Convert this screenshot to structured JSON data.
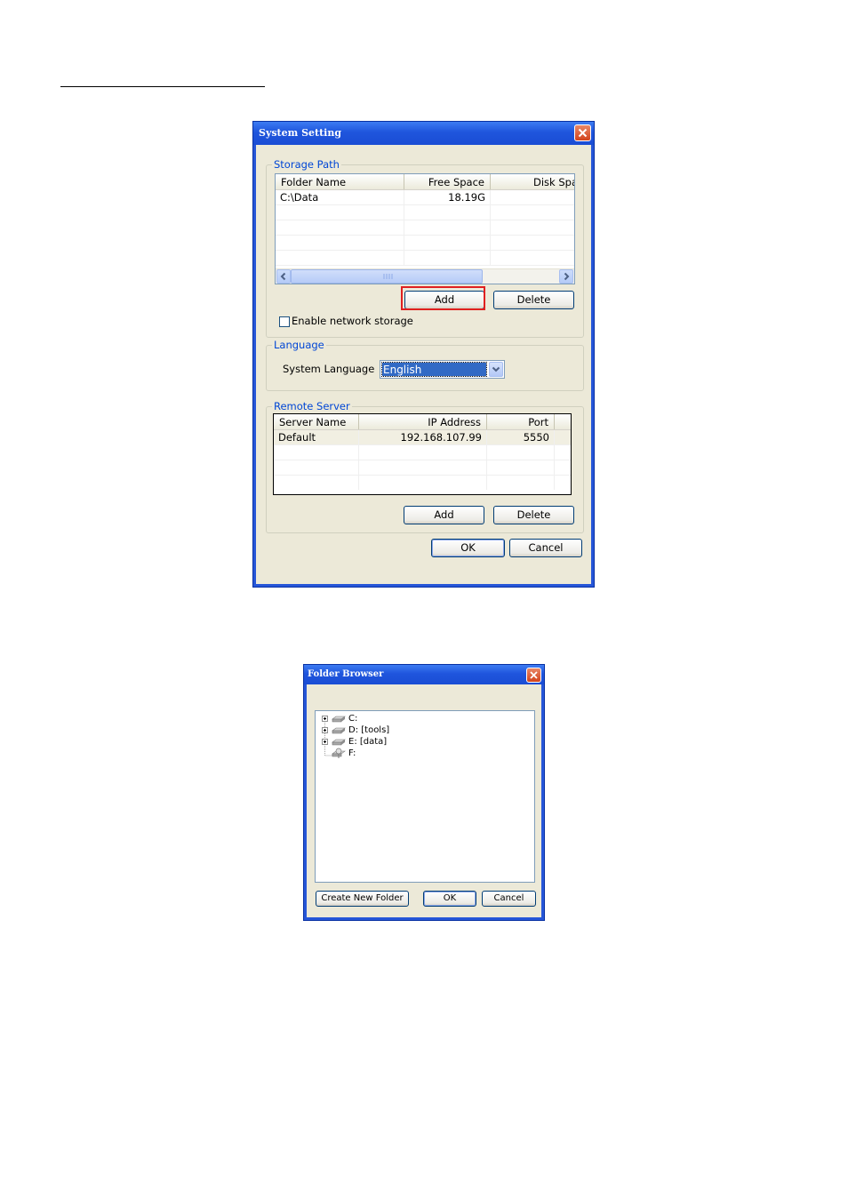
{
  "system_setting": {
    "title": "System Setting",
    "storage_path": {
      "legend": "Storage Path",
      "columns": [
        "Folder Name",
        "Free Space",
        "Disk Spa"
      ],
      "rows": [
        {
          "folder": "C:\\Data",
          "free": "18.19G",
          "disk": ""
        }
      ],
      "add_label": "Add",
      "delete_label": "Delete",
      "enable_network_label": "Enable network storage",
      "enable_network_checked": false
    },
    "language": {
      "legend": "Language",
      "system_language_label": "System Language",
      "selected": "English"
    },
    "remote_server": {
      "legend": "Remote Server",
      "columns": [
        "Server Name",
        "IP Address",
        "Port"
      ],
      "rows": [
        {
          "name": "Default",
          "ip": "192.168.107.99",
          "port": "5550"
        }
      ],
      "add_label": "Add",
      "delete_label": "Delete"
    },
    "ok_label": "OK",
    "cancel_label": "Cancel"
  },
  "folder_browser": {
    "title": "Folder Browser",
    "drives": [
      {
        "label": "C:",
        "expandable": true,
        "icon": "drive-icon"
      },
      {
        "label": "D: [tools]",
        "expandable": true,
        "icon": "drive-icon"
      },
      {
        "label": "E: [data]",
        "expandable": true,
        "icon": "drive-icon"
      },
      {
        "label": "F:",
        "expandable": false,
        "icon": "network-drive-icon"
      }
    ],
    "create_folder_label": "Create New Folder",
    "ok_label": "OK",
    "cancel_label": "Cancel"
  },
  "colors": {
    "title_bar": "#2656d8",
    "dialog_face": "#ece9d8",
    "group_legend": "#0046d5",
    "highlight_box": "#e02020",
    "selection": "#316ac5"
  }
}
